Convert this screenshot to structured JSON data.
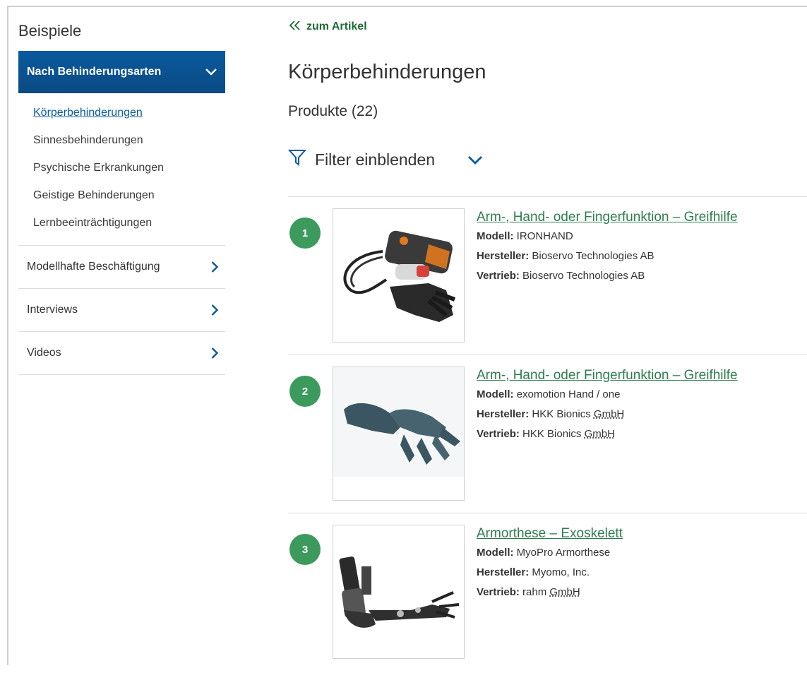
{
  "sidebar": {
    "title": "Beispiele",
    "active_section": "Nach Behinderungsarten",
    "sub_items": [
      {
        "label": "Körperbehinderungen"
      },
      {
        "label": "Sinnesbehinderungen"
      },
      {
        "label": "Psychische Erkrankungen"
      },
      {
        "label": "Geistige Behinderungen"
      },
      {
        "label": "Lernbeeinträchtigungen"
      }
    ],
    "items": [
      {
        "label": "Modellhafte Beschäftigung"
      },
      {
        "label": "Interviews"
      },
      {
        "label": "Videos"
      }
    ]
  },
  "main": {
    "back_link": "zum Artikel",
    "title": "Körperbehinderungen",
    "count": "Produkte (22)",
    "filter_label": "Filter einblenden"
  },
  "labels": {
    "model": "Modell:",
    "manufacturer": "Hersteller:",
    "distributor": "Vertrieb:"
  },
  "products": [
    {
      "number": "1",
      "title": "Arm-, Hand- oder Fingerfunktion – Greifhilfe",
      "model": "IRONHAND",
      "manufacturer": "Bioservo Technologies AB",
      "distributor": "Bioservo Technologies AB"
    },
    {
      "number": "2",
      "title": "Arm-, Hand- oder Fingerfunktion – Greifhilfe",
      "model": "exomotion Hand / one",
      "manufacturer_name": "HKK Bionics",
      "manufacturer_suffix": "GmbH",
      "distributor_name": "HKK Bionics",
      "distributor_suffix": "GmbH"
    },
    {
      "number": "3",
      "title": "Armorthese – Exoskelett",
      "model": "MyoPro Armorthese",
      "manufacturer": "Myomo, Inc.",
      "distributor_name": "rahm",
      "distributor_suffix": "GmbH"
    }
  ],
  "colors": {
    "nav_active_bg": "#0b4f8f",
    "link_green": "#2e7d4f",
    "badge_green": "#3d9a5d",
    "accent_blue": "#0a5a9e"
  }
}
